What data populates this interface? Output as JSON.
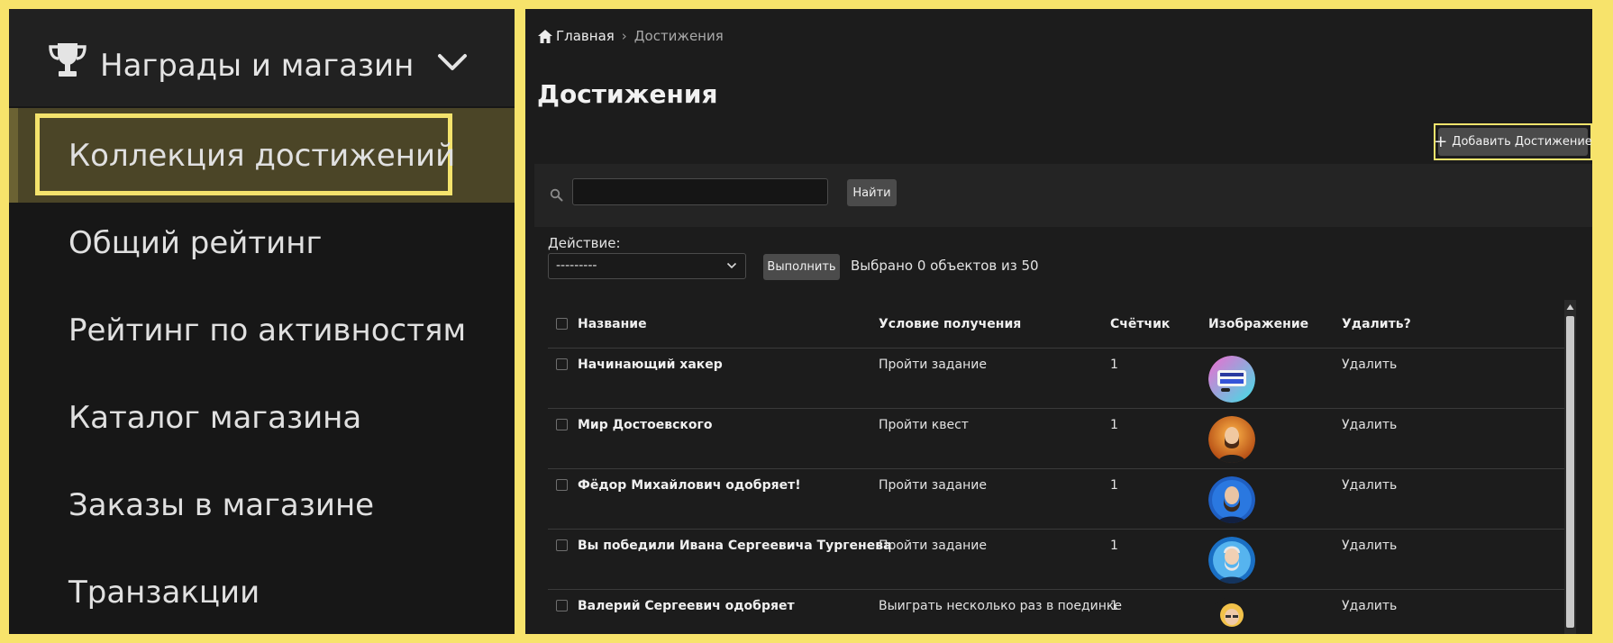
{
  "sidebar": {
    "group": {
      "title": "Награды и магазин",
      "icon": "trophy-icon",
      "toggle_icon": "chevron-down-icon"
    },
    "items": [
      {
        "label": "Коллекция достижений",
        "active": true
      },
      {
        "label": "Общий рейтинг"
      },
      {
        "label": "Рейтинг по активностям"
      },
      {
        "label": "Каталог магазина"
      },
      {
        "label": "Заказы в магазине"
      },
      {
        "label": "Транзакции"
      }
    ]
  },
  "breadcrumb": {
    "home": "Главная",
    "separator": "›",
    "current": "Достижения"
  },
  "page": {
    "title": "Достижения"
  },
  "toolbar": {
    "add_label": "Добавить Достижение"
  },
  "search": {
    "value": "",
    "button": "Найти"
  },
  "actions": {
    "label": "Действие:",
    "selected": "---------",
    "run_button": "Выполнить",
    "selected_count": "Выбрано 0 объектов из 50"
  },
  "table": {
    "headers": [
      "Название",
      "Условие получения",
      "Счётчик",
      "Изображение",
      "Удалить?"
    ],
    "rows": [
      {
        "name": "Начинающий хакер",
        "condition": "Пройти задание",
        "counter": "1",
        "delete": "Удалить"
      },
      {
        "name": "Мир Достоевского",
        "condition": "Пройти квест",
        "counter": "1",
        "delete": "Удалить"
      },
      {
        "name": "Фёдор Михайлович одобряет!",
        "condition": "Пройти задание",
        "counter": "1",
        "delete": "Удалить"
      },
      {
        "name": "Вы победили Ивана Сергеевича Тургенева",
        "condition": "Пройти задание",
        "counter": "1",
        "delete": "Удалить"
      },
      {
        "name": "Валерий Сергеевич одобряет",
        "condition": "Выиграть несколько раз в поединке",
        "counter": "1",
        "delete": "Удалить"
      }
    ]
  },
  "colors": {
    "frame": "#f7e36b",
    "highlight": "#f4e36c",
    "active_item_bg": "#4b4527",
    "panel_bg": "#1c1c1c"
  }
}
